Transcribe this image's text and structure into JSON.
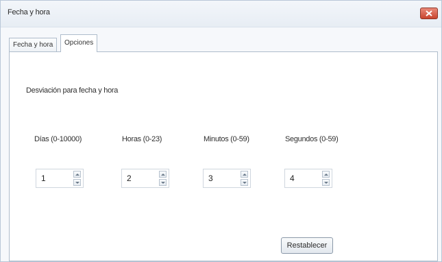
{
  "window": {
    "title": "Fecha y hora"
  },
  "tabs": [
    {
      "label": "Fecha y hora",
      "active": false
    },
    {
      "label": "Opciones",
      "active": true
    }
  ],
  "options": {
    "section_label": "Desviación para fecha y hora",
    "fields": [
      {
        "label": "Días (0-10000)",
        "value": "1"
      },
      {
        "label": "Horas (0-23)",
        "value": "2"
      },
      {
        "label": "Minutos (0-59)",
        "value": "3"
      },
      {
        "label": "Segundos (0-59)",
        "value": "4"
      }
    ],
    "reset_label": "Restablecer"
  },
  "icons": {
    "close": "close-icon",
    "spin_up": "chevron-up-icon",
    "spin_down": "chevron-down-icon"
  },
  "colors": {
    "close_button": "#c8442f",
    "border": "#aebccb"
  }
}
